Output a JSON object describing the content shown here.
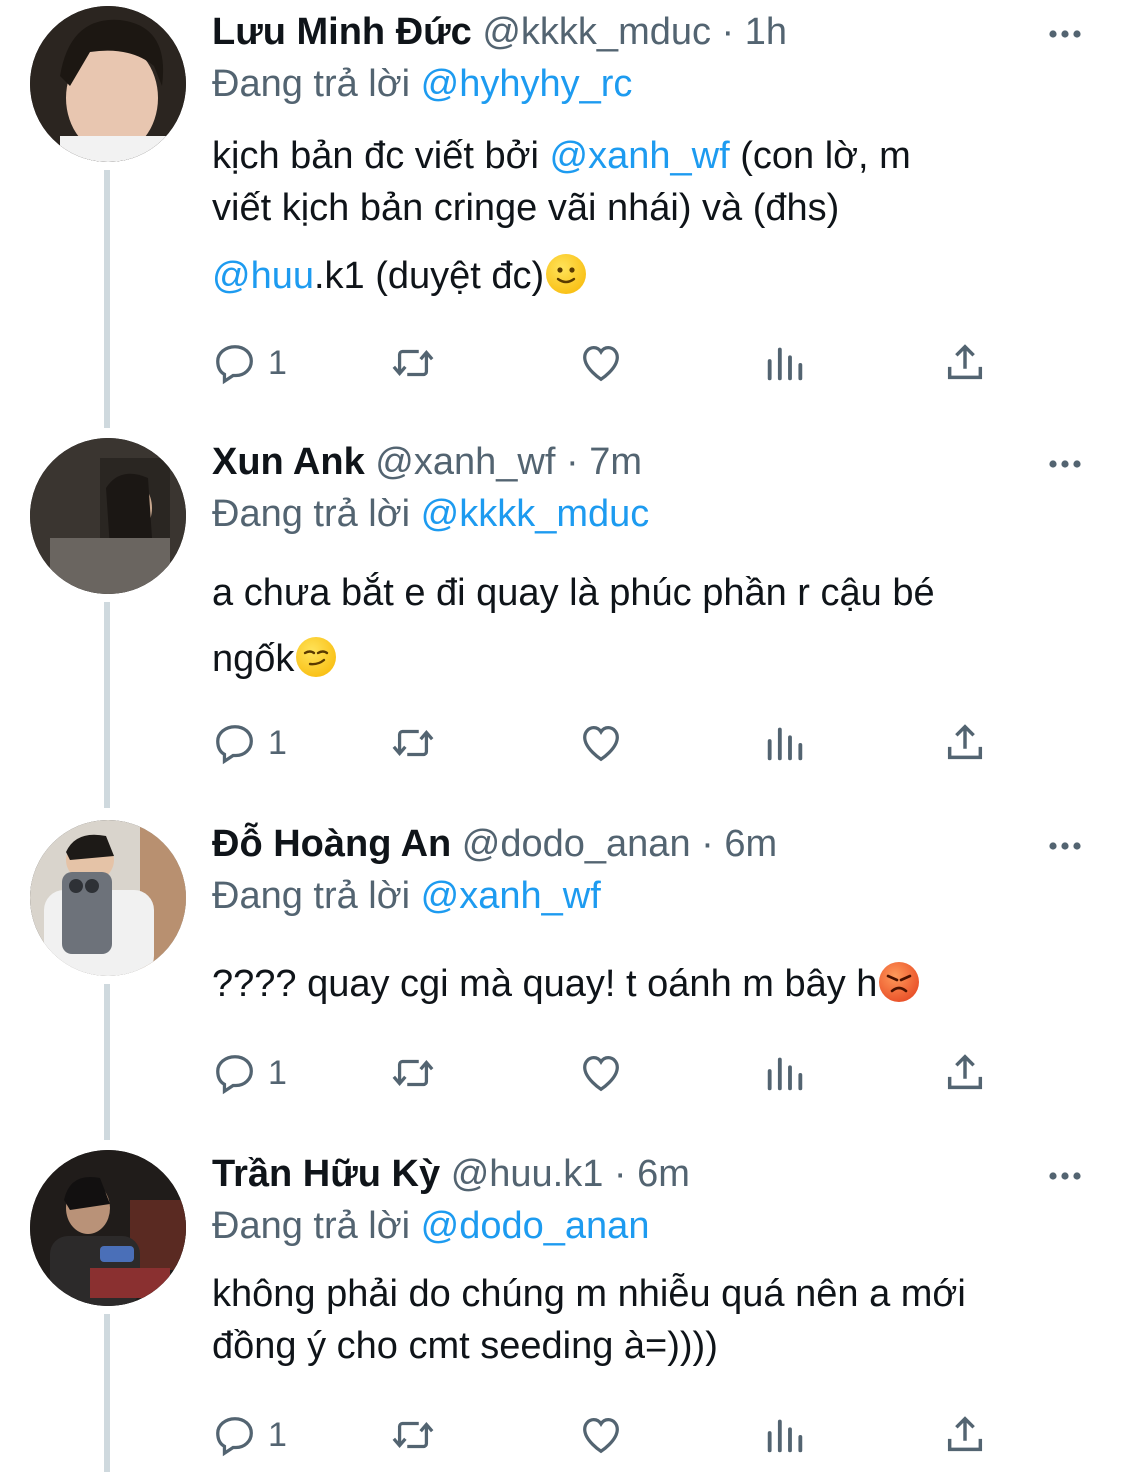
{
  "tweets": [
    {
      "name": "Lưu Minh Đức",
      "handle": "@kkkk_mduc",
      "sep": " · ",
      "time": "1h",
      "reply_prefix": "Đang trả lời ",
      "reply_to": "@hyhyhy_rc",
      "text_1a": "kịch bản đc viết bởi ",
      "text_1b": "@xanh_wf",
      "text_1c": " (con lờ, m",
      "text_2": "viết kịch bản cringe vãi nhái) và (đhs)",
      "text_3a": "@huu",
      "text_3b": ".k1 (duyệt đc)",
      "emoji": "slightly-smiling-face",
      "reply_count": "1"
    },
    {
      "name": "Xun Ank",
      "handle": "@xanh_wf",
      "sep": " · ",
      "time": "7m",
      "reply_prefix": "Đang trả lời ",
      "reply_to": "@kkkk_mduc",
      "text_1": "a chưa bắt e đi quay là phúc phần r cậu bé",
      "text_2": "ngốk",
      "emoji": "smirking-face",
      "reply_count": "1"
    },
    {
      "name": "Đỗ Hoàng An",
      "handle": "@dodo_anan",
      "sep": " · ",
      "time": "6m",
      "reply_prefix": "Đang trả lời ",
      "reply_to": "@xanh_wf",
      "text_1": "???? quay cgi mà quay! t oánh m bây h",
      "emoji": "angry-face",
      "reply_count": "1"
    },
    {
      "name": "Trần Hữu Kỳ",
      "handle": "@huu.k1",
      "sep": " · ",
      "time": "6m",
      "reply_prefix": "Đang trả lời ",
      "reply_to": "@dodo_anan",
      "text_1": "không phải do chúng m nhiễu quá nên a mới",
      "text_2": "đồng ý cho cmt seeding à=))))",
      "reply_count": "1"
    }
  ],
  "icons": [
    "reply-icon",
    "retweet-icon",
    "like-icon",
    "views-icon",
    "share-icon",
    "more-icon"
  ],
  "colors": {
    "link": "#1d9bf0",
    "meta": "#536471",
    "text": "#0f1419",
    "thread_line": "#cfd9de"
  }
}
